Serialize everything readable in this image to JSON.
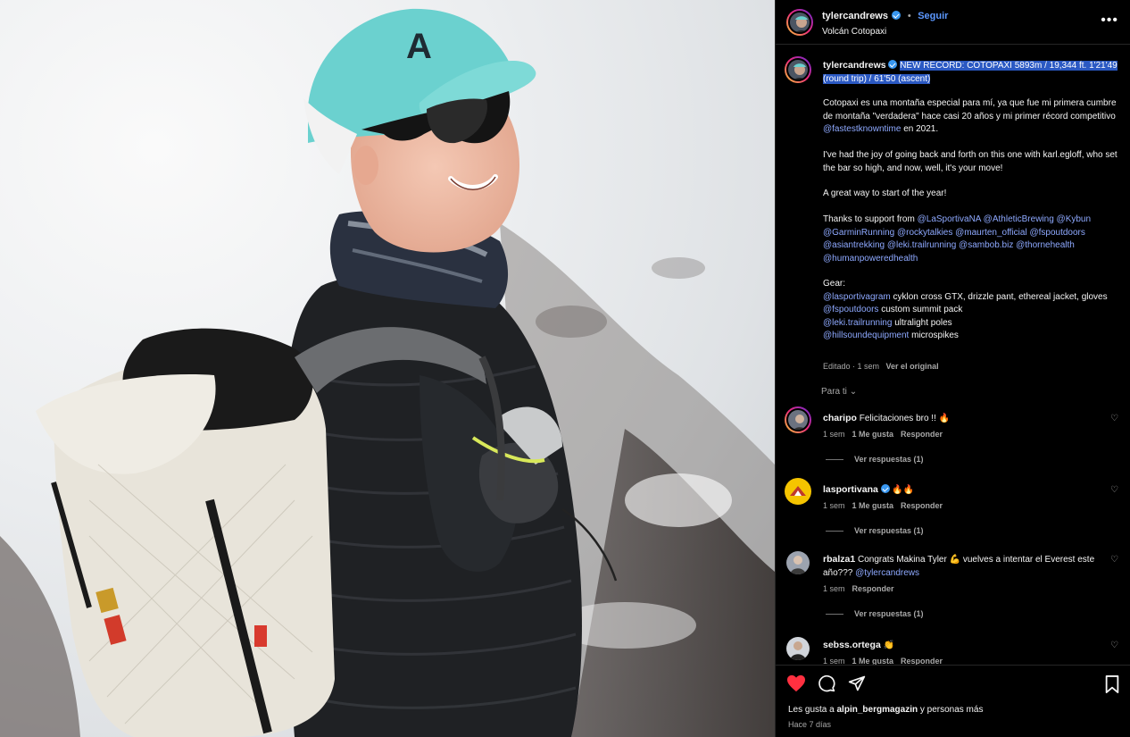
{
  "post": {
    "author": "tylercandrews",
    "location": "Volcán Cotopaxi",
    "follow_label": "Seguir",
    "separator": "•",
    "more_label": "•••"
  },
  "caption": {
    "username": "tylercandrews",
    "headline": "NEW RECORD: COTOPAXI 5893m / 19,344 ft. 1'21'49 (round trip) / 61'50 (ascent)",
    "p1_text": "Cotopaxi es una montaña especial para mí, ya que fue mi primera cumbre de montaña \"verdadera\" hace casi 20 años y mi primer récord competitivo",
    "p1_mention": "@fastestknowntime",
    "p1_tail": "en 2021.",
    "p2": "I've had the joy of going back and forth on this one with karl.egloff, who set the bar so high, and now, well, it's your move!",
    "p3": "A great way to start of the year!",
    "p4_text": "Thanks to support from",
    "p4_mentions": "@LaSportivaNA @AthleticBrewing @Kybun @GarminRunning @rockytalkies @maurten_official @fspoutdoors @asiantrekking @leki.trailrunning @sambob.biz @thornehealth @humanpoweredhealth",
    "gear_title": "Gear:",
    "gear": [
      {
        "mention": "@lasportivagram",
        "text": "cyklon cross GTX, drizzle pant, ethereal jacket, gloves"
      },
      {
        "mention": "@fspoutdoors",
        "text": "custom summit pack"
      },
      {
        "mention": "@leki.trailrunning",
        "text": "ultralight poles"
      },
      {
        "mention": "@hillsoundequipment",
        "text": "microspikes"
      }
    ],
    "edited": "Editado · 1 sem",
    "see_original": "Ver el original"
  },
  "for_you_label": "Para ti",
  "comments": [
    {
      "username": "charipo",
      "text": "Felicitaciones bro !! 🔥",
      "mention": "",
      "time": "1 sem",
      "likes": "1 Me gusta",
      "reply": "Responder",
      "replies": "Ver respuestas (1)",
      "verified": false
    },
    {
      "username": "lasportivana",
      "text": "🔥🔥",
      "mention": "",
      "time": "1 sem",
      "likes": "1 Me gusta",
      "reply": "Responder",
      "replies": "Ver respuestas (1)",
      "verified": true
    },
    {
      "username": "rbalza1",
      "text": "Congrats Makina Tyler 💪 vuelves a intentar el Everest este año???",
      "mention": "@tylercandrews",
      "time": "1 sem",
      "likes": "",
      "reply": "Responder",
      "replies": "Ver respuestas (1)",
      "verified": false
    },
    {
      "username": "sebss.ortega",
      "text": "👏",
      "mention": "",
      "time": "1 sem",
      "likes": "1 Me gusta",
      "reply": "Responder",
      "replies": "",
      "verified": false
    }
  ],
  "footer": {
    "likes_prefix": "Les gusta a",
    "likes_user": "alpin_bergmagazin",
    "likes_suffix": "y personas más",
    "date": "Hace 7 días"
  },
  "colors": {
    "background": "#000000",
    "link": "#5c98ff",
    "mention": "#8ea9ff",
    "highlight": "#2b59c3",
    "like_red": "#ff3040",
    "verified": "#3897f0"
  }
}
